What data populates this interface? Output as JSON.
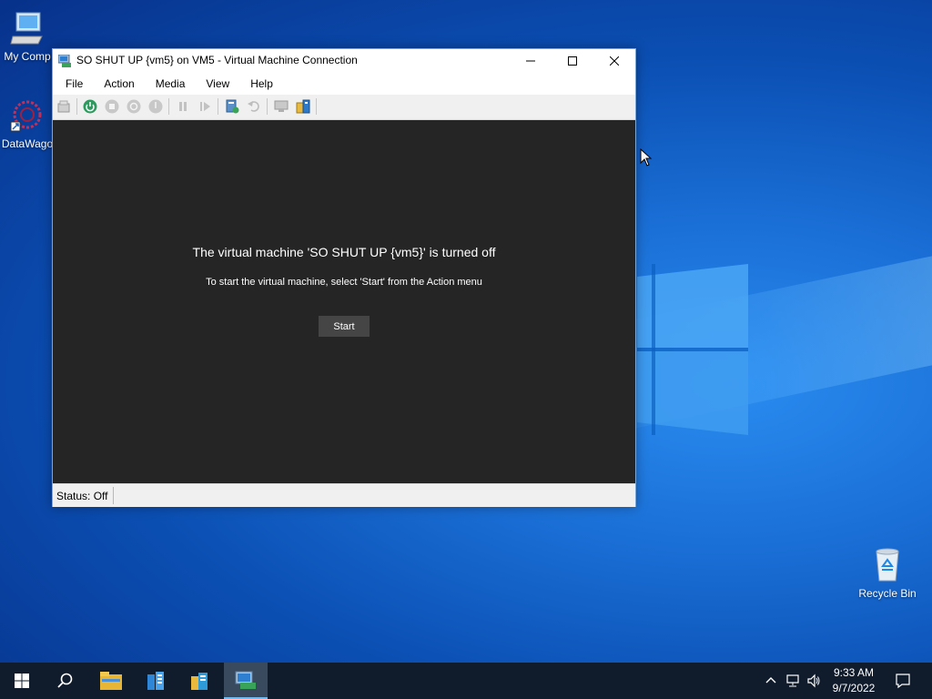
{
  "desktop": {
    "icons": [
      {
        "label": "My Comp"
      },
      {
        "label": "DataWago"
      },
      {
        "label": "Recycle Bin"
      }
    ]
  },
  "window": {
    "title": "SO SHUT UP {vm5} on VM5 - Virtual Machine Connection",
    "menu": [
      "File",
      "Action",
      "Media",
      "View",
      "Help"
    ],
    "message_title": "The virtual machine 'SO SHUT UP {vm5}' is turned off",
    "message_sub": "To start the virtual machine, select 'Start' from the Action menu",
    "start_label": "Start",
    "status": "Status: Off"
  },
  "taskbar": {
    "time": "9:33 AM",
    "date": "9/7/2022"
  },
  "colors": {
    "accent": "#76b9ed",
    "vm_screen": "#252525",
    "taskbar": "#101c2c"
  }
}
